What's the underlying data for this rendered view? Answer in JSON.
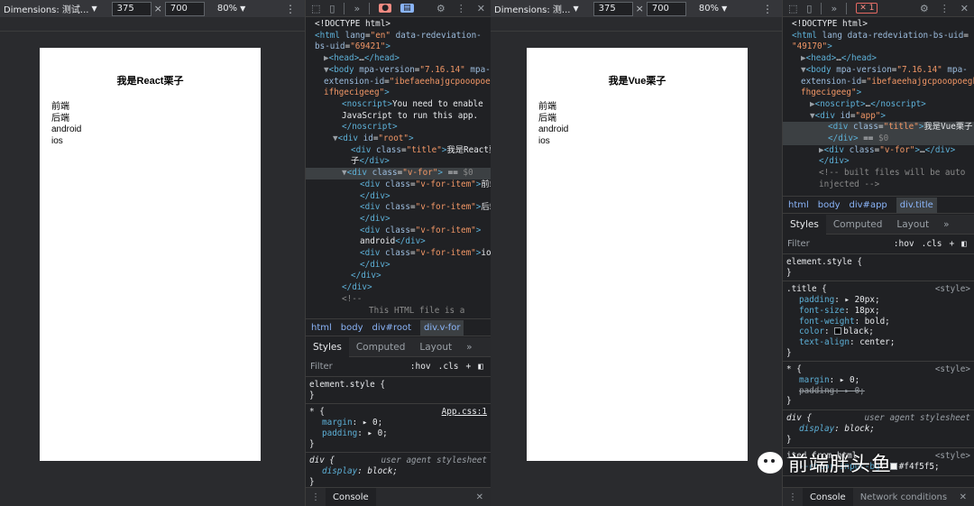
{
  "left": {
    "device_bar": {
      "dimensions_label": "Dimensions: 测试...",
      "width_value": "375",
      "times": "×",
      "height_value": "700",
      "zoom": "80%"
    },
    "page": {
      "title": "我是React栗子",
      "items": [
        "前端",
        "后端",
        "android",
        "ios"
      ]
    },
    "devtools": {
      "dom_lines": [
        {
          "indent": 0,
          "html": "&lt;!DOCTYPE html&gt;"
        },
        {
          "indent": 0,
          "html": "<span class='t'>&lt;html</span> <span class='a'>lang</span>=<span class='v'>\"en\"</span> <span class='a'>data-redeviation-</span>"
        },
        {
          "indent": 0,
          "html": "<span class='a'>bs-uid</span>=<span class='v'>\"69421\"</span><span class='t'>&gt;</span>"
        },
        {
          "indent": 1,
          "html": "<span class='ar'>▶</span><span class='t'>&lt;head&gt;</span>…<span class='t'>&lt;/head&gt;</span>"
        },
        {
          "indent": 1,
          "html": "<span class='ar'>▼</span><span class='t'>&lt;body</span> <span class='a'>mpa-version</span>=<span class='v'>\"7.16.14\"</span> <span class='a'>mpa-</span>"
        },
        {
          "indent": 1,
          "html": "<span class='a'>extension-id</span>=<span class='v'>\"ibefaeehajgcpooopoegk</span>"
        },
        {
          "indent": 1,
          "html": "<span class='v'>ifhgecigeeg\"</span><span class='t'>&gt;</span>"
        },
        {
          "indent": 3,
          "html": "<span class='t'>&lt;noscript&gt;</span>You need to enable"
        },
        {
          "indent": 3,
          "html": "JavaScript to run this app."
        },
        {
          "indent": 3,
          "html": "<span class='t'>&lt;/noscript&gt;</span>"
        },
        {
          "indent": 2,
          "html": "<span class='ar'>▼</span><span class='t'>&lt;div</span> <span class='a'>id</span>=<span class='v'>\"root\"</span><span class='t'>&gt;</span>"
        },
        {
          "indent": 4,
          "html": "<span class='t'>&lt;div</span> <span class='a'>class</span>=<span class='v'>\"title\"</span><span class='t'>&gt;</span>我是React栗"
        },
        {
          "indent": 4,
          "html": "子<span class='t'>&lt;/div&gt;</span>"
        },
        {
          "indent": 3,
          "hl": true,
          "html": "<span class='ar'>▼</span><span class='t'>&lt;div</span> <span class='a'>class</span>=<span class='v'>\"v-for\"</span><span class='t'>&gt;</span> == <span class='c'>$0</span>"
        },
        {
          "indent": 5,
          "html": "<span class='t'>&lt;div</span> <span class='a'>class</span>=<span class='v'>\"v-for-item\"</span><span class='t'>&gt;</span>前端"
        },
        {
          "indent": 5,
          "html": "<span class='t'>&lt;/div&gt;</span>"
        },
        {
          "indent": 5,
          "html": "<span class='t'>&lt;div</span> <span class='a'>class</span>=<span class='v'>\"v-for-item\"</span><span class='t'>&gt;</span>后端"
        },
        {
          "indent": 5,
          "html": "<span class='t'>&lt;/div&gt;</span>"
        },
        {
          "indent": 5,
          "html": "<span class='t'>&lt;div</span> <span class='a'>class</span>=<span class='v'>\"v-for-item\"</span><span class='t'>&gt;</span>"
        },
        {
          "indent": 5,
          "html": "android<span class='t'>&lt;/div&gt;</span>"
        },
        {
          "indent": 5,
          "html": "<span class='t'>&lt;div</span> <span class='a'>class</span>=<span class='v'>\"v-for-item\"</span><span class='t'>&gt;</span>ios"
        },
        {
          "indent": 5,
          "html": "<span class='t'>&lt;/div&gt;</span>"
        },
        {
          "indent": 4,
          "html": "<span class='t'>&lt;/div&gt;</span>"
        },
        {
          "indent": 3,
          "html": "<span class='t'>&lt;/div&gt;</span>"
        },
        {
          "indent": 3,
          "html": "<span class='c'>&lt;!--</span>"
        },
        {
          "indent": 6,
          "html": "<span class='c'>This HTML file is a</span>"
        }
      ],
      "crumbs": [
        "html",
        "body",
        "div#root",
        "div.v-for"
      ],
      "tabs": [
        "Styles",
        "Computed",
        "Layout"
      ],
      "filter_placeholder": "Filter",
      "hov": ":hov",
      "cls": ".cls",
      "rules": [
        {
          "selector": "element.style {",
          "source": "",
          "props": [],
          "close": "}"
        },
        {
          "selector": "* {",
          "source": "App.css:1",
          "src_class": "u",
          "props": [
            {
              "n": "margin",
              "v": "▸ 0;"
            },
            {
              "n": "padding",
              "v": "▸ 0;"
            }
          ],
          "close": "}"
        },
        {
          "selector": "div {",
          "source": "user agent stylesheet",
          "src_class": "i",
          "italic": true,
          "props": [
            {
              "n": "display",
              "v": "block;",
              "italic": true
            }
          ],
          "close": "}"
        }
      ],
      "console_tab": "Console"
    }
  },
  "right": {
    "device_bar": {
      "dimensions_label": "Dimensions: 测...",
      "width_value": "375",
      "times": "×",
      "height_value": "700",
      "zoom": "80%"
    },
    "page": {
      "title": "我是Vue栗子",
      "items": [
        "前端",
        "后端",
        "android",
        "ios"
      ]
    },
    "devtools": {
      "error_count": "1",
      "dom_lines": [
        {
          "indent": 0,
          "html": "&lt;!DOCTYPE html&gt;"
        },
        {
          "indent": 0,
          "html": "<span class='t'>&lt;html</span> <span class='a'>lang data-redeviation-bs-uid</span>="
        },
        {
          "indent": 0,
          "html": "<span class='v'>\"49170\"</span><span class='t'>&gt;</span>"
        },
        {
          "indent": 1,
          "html": "<span class='ar'>▶</span><span class='t'>&lt;head&gt;</span>…<span class='t'>&lt;/head&gt;</span>"
        },
        {
          "indent": 1,
          "html": "<span class='ar'>▼</span><span class='t'>&lt;body</span> <span class='a'>mpa-version</span>=<span class='v'>\"7.16.14\"</span> <span class='a'>mpa-</span>"
        },
        {
          "indent": 1,
          "html": "<span class='a'>extension-id</span>=<span class='v'>\"ibefaeehajgcpooopoegki</span>"
        },
        {
          "indent": 1,
          "html": "<span class='v'>fhgecigeeg\"</span><span class='t'>&gt;</span>"
        },
        {
          "indent": 2,
          "html": "<span class='ar'>▶</span><span class='t'>&lt;noscript&gt;</span>…<span class='t'>&lt;/noscript&gt;</span>"
        },
        {
          "indent": 2,
          "html": "<span class='ar'>▼</span><span class='t'>&lt;div</span> <span class='a'>id</span>=<span class='v'>\"app\"</span><span class='t'>&gt;</span>"
        },
        {
          "indent": 4,
          "hl": true,
          "html": "<span class='t'>&lt;div</span> <span class='a'>class</span>=<span class='v'>\"title\"</span><span class='t'>&gt;</span>我是Vue栗子"
        },
        {
          "indent": 4,
          "hl": true,
          "html": "<span class='t'>&lt;/div&gt;</span> == <span class='c'>$0</span>"
        },
        {
          "indent": 3,
          "html": "<span class='ar'>▶</span><span class='t'>&lt;div</span> <span class='a'>class</span>=<span class='v'>\"v-for\"</span><span class='t'>&gt;</span>…<span class='t'>&lt;/div&gt;</span>"
        },
        {
          "indent": 3,
          "html": "<span class='t'>&lt;/div&gt;</span>"
        },
        {
          "indent": 3,
          "html": "<span class='c'>&lt;!-- built files will be auto</span>"
        },
        {
          "indent": 3,
          "html": "<span class='c'>injected --&gt;</span>"
        }
      ],
      "crumbs": [
        "html",
        "body",
        "div#app",
        "div.title"
      ],
      "tabs": [
        "Styles",
        "Computed",
        "Layout"
      ],
      "filter_placeholder": "Filter",
      "hov": ":hov",
      "cls": ".cls",
      "rules": [
        {
          "selector": "element.style {",
          "source": "",
          "props": [],
          "close": "}"
        },
        {
          "selector": ".title {",
          "source": "<style>",
          "props": [
            {
              "n": "padding",
              "v": "▸ 20px;"
            },
            {
              "n": "font-size",
              "v": "18px;"
            },
            {
              "n": "font-weight",
              "v": "bold;"
            },
            {
              "n": "color",
              "v": "black;",
              "swatch": "#000000"
            },
            {
              "n": "text-align",
              "v": "center;"
            }
          ],
          "close": "}"
        },
        {
          "selector": "* {",
          "source": "<style>",
          "props": [
            {
              "n": "margin",
              "v": "▸ 0;"
            },
            {
              "n": "padding",
              "v": "▸ 0;",
              "strike": true
            }
          ],
          "close": "}"
        },
        {
          "selector": "div {",
          "source": "user agent stylesheet",
          "src_class": "i",
          "italic": true,
          "props": [
            {
              "n": "display",
              "v": "block;",
              "italic": true
            }
          ],
          "close": "}"
        },
        {
          "selector": "ited from html",
          "source": "<style>",
          "props": [
            {
              "n": "--color-input-bg",
              "v": "#f4f5f5;",
              "swatch": "#f4f5f5"
            }
          ],
          "close": ""
        }
      ],
      "console_tabs": [
        "Console",
        "Network conditions"
      ]
    }
  },
  "watermark": {
    "text": "前端胖头鱼"
  }
}
